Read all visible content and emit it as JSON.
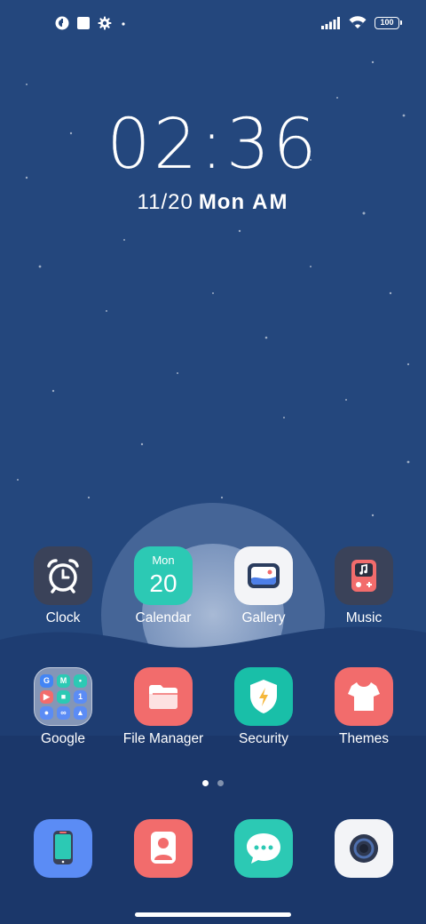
{
  "status_bar": {
    "left_icons": [
      "app-notification-icon",
      "square-notification-icon",
      "settings-gear-icon",
      "more-dot-icon"
    ],
    "right_icons": [
      "signal-icon",
      "wifi-icon",
      "battery-icon"
    ],
    "battery_level": "100"
  },
  "lockclock": {
    "time": "02:36",
    "date": "11/20",
    "weekday": "Mon",
    "ampm": "AM"
  },
  "home_row1": [
    {
      "label": "Clock",
      "icon": "alarm-clock-icon"
    },
    {
      "label": "Calendar",
      "icon": "calendar-icon",
      "month": "Mon",
      "day": "20"
    },
    {
      "label": "Gallery",
      "icon": "gallery-icon"
    },
    {
      "label": "Music",
      "icon": "music-icon"
    }
  ],
  "home_row2": [
    {
      "label": "Google",
      "icon": "google-folder-icon"
    },
    {
      "label": "File Manager",
      "icon": "folder-icon"
    },
    {
      "label": "Security",
      "icon": "shield-icon"
    },
    {
      "label": "Themes",
      "icon": "tshirt-icon"
    }
  ],
  "dock": [
    {
      "icon": "phone-icon"
    },
    {
      "icon": "contacts-icon"
    },
    {
      "icon": "messages-icon"
    },
    {
      "icon": "camera-icon"
    }
  ],
  "pages": {
    "count": 2,
    "active": 0
  },
  "colors": {
    "sky": "#24477d",
    "ground": "#1d3a6c",
    "teal": "#2cc9b4",
    "coral": "#f26c6c",
    "blue_app": "#5b8cf5",
    "dark_app": "#3a4259"
  }
}
